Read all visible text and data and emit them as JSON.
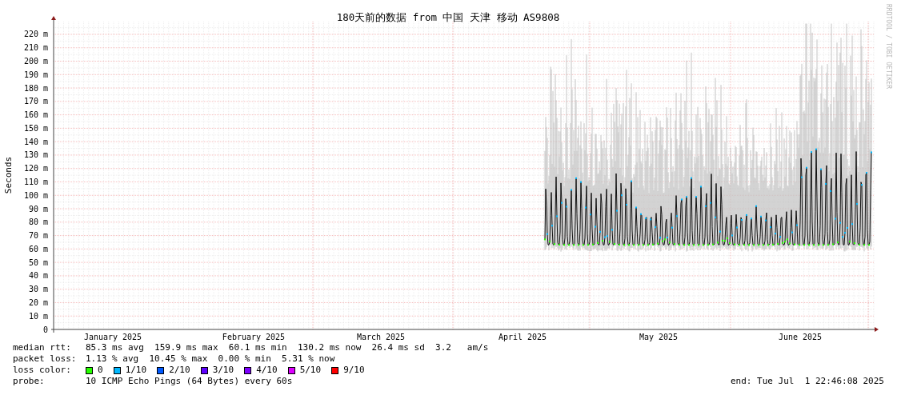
{
  "title": "180天前的数据 from 中国 天津 移动 AS9808",
  "credit": "RRDTOOL / TOBI OETIKER",
  "y_axis": {
    "label": "Seconds",
    "ticks": [
      "220 m",
      "210 m",
      "200 m",
      "190 m",
      "180 m",
      "170 m",
      "160 m",
      "150 m",
      "140 m",
      "130 m",
      "120 m",
      "110 m",
      "100 m",
      "90 m",
      "80 m",
      "70 m",
      "60 m",
      "50 m",
      "40 m",
      "30 m",
      "20 m",
      "10 m",
      "0"
    ]
  },
  "x_axis": {
    "months": [
      "January 2025",
      "February 2025",
      "March 2025",
      "April 2025",
      "May 2025",
      "June 2025"
    ]
  },
  "stats": [
    {
      "label": "median rtt:",
      "value": "85.3 ms avg  159.9 ms max  60.1 ms min  130.2 ms now  26.4 ms sd  3.2   am/s"
    },
    {
      "label": "packet loss:",
      "value": "1.13 % avg  10.45 % max  0.00 % min  5.31 % now"
    }
  ],
  "loss_legend": {
    "label": "loss color:",
    "items": [
      {
        "text": "0",
        "color": "#26ff00"
      },
      {
        "text": "1/10",
        "color": "#00b8ff"
      },
      {
        "text": "2/10",
        "color": "#0059ff"
      },
      {
        "text": "3/10",
        "color": "#5e00ff"
      },
      {
        "text": "4/10",
        "color": "#7e00ff"
      },
      {
        "text": "5/10",
        "color": "#dd00ff"
      },
      {
        "text": "9/10",
        "color": "#ff0000"
      }
    ]
  },
  "probe": {
    "label": "probe:",
    "value": "10 ICMP Echo Pings (64 Bytes) every 60s"
  },
  "end": "end: Tue Jul  1 22:46:08 2025"
}
